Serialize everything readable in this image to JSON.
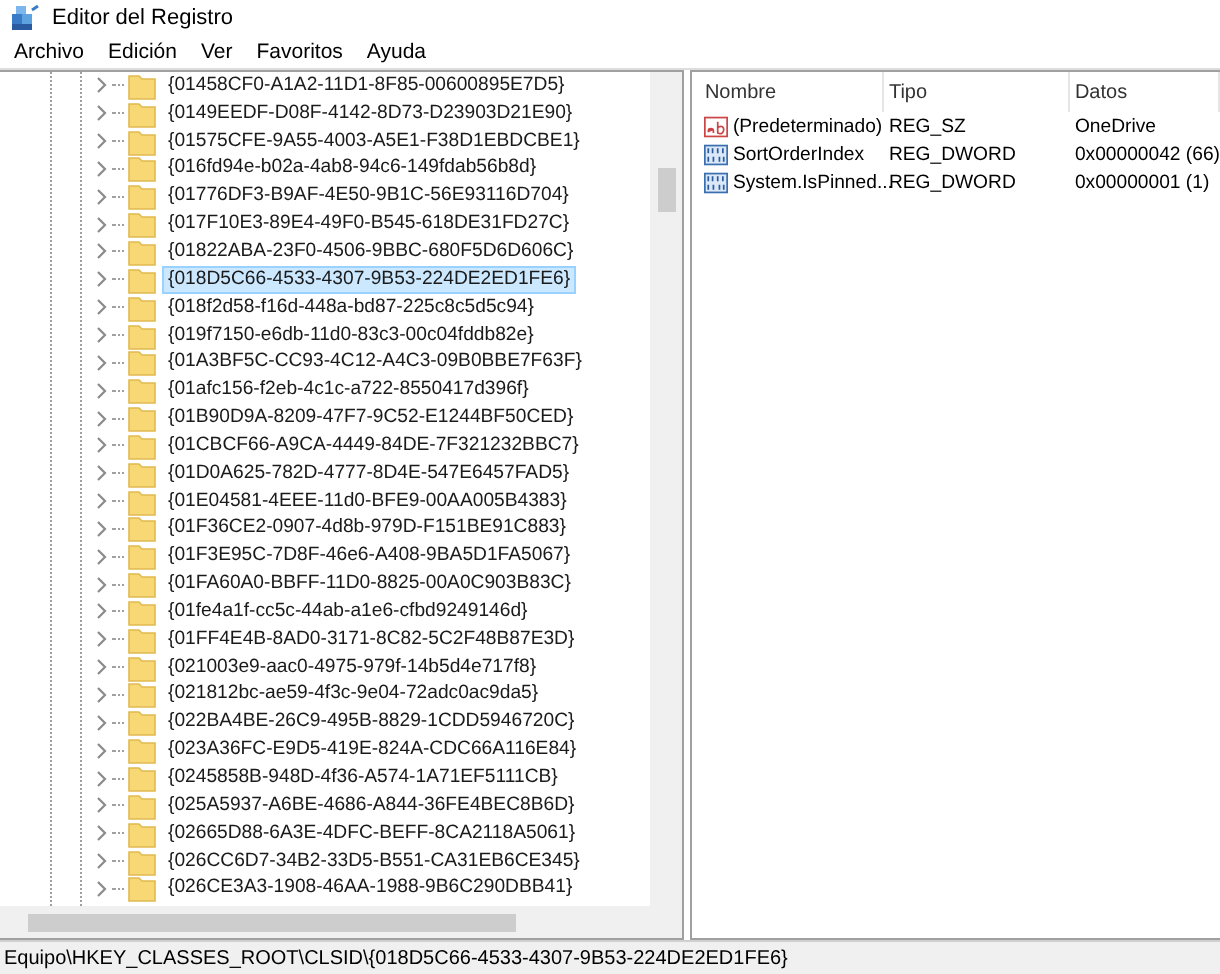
{
  "window": {
    "title": "Editor del Registro"
  },
  "menu": [
    "Archivo",
    "Edición",
    "Ver",
    "Favoritos",
    "Ayuda"
  ],
  "tree": {
    "items": [
      {
        "label": "{01458CF0-A1A2-11D1-8F85-00600895E7D5}",
        "selected": false
      },
      {
        "label": "{0149EEDF-D08F-4142-8D73-D23903D21E90}",
        "selected": false
      },
      {
        "label": "{01575CFE-9A55-4003-A5E1-F38D1EBDCBE1}",
        "selected": false
      },
      {
        "label": "{016fd94e-b02a-4ab8-94c6-149fdab56b8d}",
        "selected": false
      },
      {
        "label": "{01776DF3-B9AF-4E50-9B1C-56E93116D704}",
        "selected": false
      },
      {
        "label": "{017F10E3-89E4-49F0-B545-618DE31FD27C}",
        "selected": false
      },
      {
        "label": "{01822ABA-23F0-4506-9BBC-680F5D6D606C}",
        "selected": false
      },
      {
        "label": "{018D5C66-4533-4307-9B53-224DE2ED1FE6}",
        "selected": true
      },
      {
        "label": "{018f2d58-f16d-448a-bd87-225c8c5d5c94}",
        "selected": false
      },
      {
        "label": "{019f7150-e6db-11d0-83c3-00c04fddb82e}",
        "selected": false
      },
      {
        "label": "{01A3BF5C-CC93-4C12-A4C3-09B0BBE7F63F}",
        "selected": false
      },
      {
        "label": "{01afc156-f2eb-4c1c-a722-8550417d396f}",
        "selected": false
      },
      {
        "label": "{01B90D9A-8209-47F7-9C52-E1244BF50CED}",
        "selected": false
      },
      {
        "label": "{01CBCF66-A9CA-4449-84DE-7F321232BBC7}",
        "selected": false
      },
      {
        "label": "{01D0A625-782D-4777-8D4E-547E6457FAD5}",
        "selected": false
      },
      {
        "label": "{01E04581-4EEE-11d0-BFE9-00AA005B4383}",
        "selected": false
      },
      {
        "label": "{01F36CE2-0907-4d8b-979D-F151BE91C883}",
        "selected": false
      },
      {
        "label": "{01F3E95C-7D8F-46e6-A408-9BA5D1FA5067}",
        "selected": false
      },
      {
        "label": "{01FA60A0-BBFF-11D0-8825-00A0C903B83C}",
        "selected": false
      },
      {
        "label": "{01fe4a1f-cc5c-44ab-a1e6-cfbd9249146d}",
        "selected": false
      },
      {
        "label": "{01FF4E4B-8AD0-3171-8C82-5C2F48B87E3D}",
        "selected": false
      },
      {
        "label": "{021003e9-aac0-4975-979f-14b5d4e717f8}",
        "selected": false
      },
      {
        "label": "{021812bc-ae59-4f3c-9e04-72adc0ac9da5}",
        "selected": false
      },
      {
        "label": "{022BA4BE-26C9-495B-8829-1CDD5946720C}",
        "selected": false
      },
      {
        "label": "{023A36FC-E9D5-419E-824A-CDC66A116E84}",
        "selected": false
      },
      {
        "label": "{0245858B-948D-4f36-A574-1A71EF5111CB}",
        "selected": false
      },
      {
        "label": "{025A5937-A6BE-4686-A844-36FE4BEC8B6D}",
        "selected": false
      },
      {
        "label": "{02665D88-6A3E-4DFC-BEFF-8CA2118A5061}",
        "selected": false
      },
      {
        "label": "{026CC6D7-34B2-33D5-B551-CA31EB6CE345}",
        "selected": false
      },
      {
        "label": "{026CE3A3-1908-46AA-1988-9B6C290DBB41}",
        "selected": false
      }
    ]
  },
  "values": {
    "columns": [
      "Nombre",
      "Tipo",
      "Datos"
    ],
    "rows": [
      {
        "kind": "string",
        "name": "(Predeterminado)",
        "type": "REG_SZ",
        "data": "OneDrive"
      },
      {
        "kind": "binary",
        "name": "SortOrderIndex",
        "type": "REG_DWORD",
        "data": "0x00000042 (66)"
      },
      {
        "kind": "binary",
        "name": "System.IsPinned...",
        "type": "REG_DWORD",
        "data": "0x00000001 (1)"
      }
    ]
  },
  "status_bar": "Equipo\\HKEY_CLASSES_ROOT\\CLSID\\{018D5C66-4533-4307-9B53-224DE2ED1FE6}"
}
